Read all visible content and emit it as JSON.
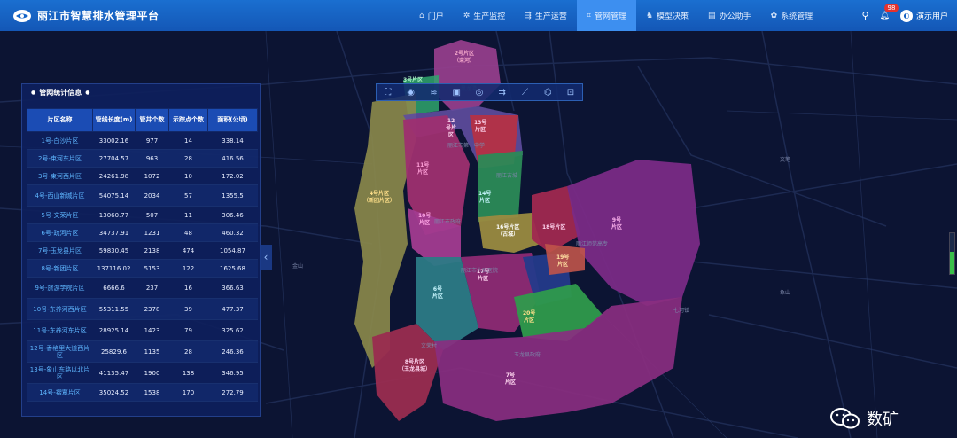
{
  "app": {
    "title": "丽江市智慧排水管理平台"
  },
  "nav": [
    {
      "label": "门户",
      "icon": "home-icon",
      "glyph": "⌂"
    },
    {
      "label": "生产监控",
      "icon": "gear-icon",
      "glyph": "✲"
    },
    {
      "label": "生产运营",
      "icon": "flow-icon",
      "glyph": "⇶"
    },
    {
      "label": "管网管理",
      "icon": "network-icon",
      "glyph": "⌗"
    },
    {
      "label": "模型决策",
      "icon": "model-icon",
      "glyph": "♞"
    },
    {
      "label": "办公助手",
      "icon": "document-icon",
      "glyph": "▤"
    },
    {
      "label": "系统管理",
      "icon": "settings-icon",
      "glyph": "✿"
    }
  ],
  "header_right": {
    "badge_count": "98",
    "user": "演示用户"
  },
  "panel": {
    "title": "管网统计信息",
    "columns": [
      "片区名称",
      "管线长度(m)",
      "管井个数",
      "示踪点个数",
      "面积(公顷)"
    ],
    "rows": [
      [
        "1号-白沙片区",
        "33002.16",
        "977",
        "14",
        "338.14"
      ],
      [
        "2号-束河东片区",
        "27704.57",
        "963",
        "28",
        "416.56"
      ],
      [
        "3号-束河西片区",
        "24261.98",
        "1072",
        "10",
        "172.02"
      ],
      [
        "4号-西山新城片区",
        "54075.14",
        "2034",
        "57",
        "1355.5"
      ],
      [
        "5号-文荣片区",
        "13060.77",
        "507",
        "11",
        "306.46"
      ],
      [
        "6号-疏河片区",
        "34737.91",
        "1231",
        "48",
        "460.32"
      ],
      [
        "7号-玉龙县片区",
        "59830.45",
        "2138",
        "474",
        "1054.87"
      ],
      [
        "8号-新团片区",
        "137116.02",
        "5153",
        "122",
        "1625.68"
      ],
      [
        "9号-旅游学院片区",
        "6666.6",
        "237",
        "16",
        "366.63"
      ],
      [
        "10号-东养河西片区",
        "55311.55",
        "2378",
        "39",
        "477.37"
      ],
      [
        "11号-东养河东片区",
        "28925.14",
        "1423",
        "79",
        "325.62"
      ],
      [
        "12号-香格里大道西片区",
        "25829.6",
        "1135",
        "28",
        "246.36"
      ],
      [
        "13号-象山东路以北片区",
        "41135.47",
        "1900",
        "138",
        "346.95"
      ],
      [
        "14号-褶覃片区",
        "35024.52",
        "1538",
        "170",
        "272.79"
      ]
    ]
  },
  "toolbar": [
    {
      "icon": "fullscreen-icon",
      "glyph": "⛶"
    },
    {
      "icon": "eye-icon",
      "glyph": "◉"
    },
    {
      "icon": "layers-icon",
      "glyph": "≋"
    },
    {
      "icon": "cube-icon",
      "glyph": "▣"
    },
    {
      "icon": "target-icon",
      "glyph": "◎"
    },
    {
      "icon": "filter-icon",
      "glyph": "⇉"
    },
    {
      "icon": "measure-icon",
      "glyph": "⟋"
    },
    {
      "icon": "route-icon",
      "glyph": "⌬"
    },
    {
      "icon": "select-icon",
      "glyph": "⊡"
    }
  ],
  "map": {
    "zones": [
      {
        "label": "2号片区\n（束河）",
        "color": "#f0a3c8"
      },
      {
        "label": "3号片区",
        "color": "#aef5c7"
      },
      {
        "label": "4号片区\n（新团片区）",
        "color": "#ffe08a"
      },
      {
        "label": "12\n号片\n区",
        "color": "#ffd6f0"
      },
      {
        "label": "13号\n片区",
        "color": "#ffd6f0"
      },
      {
        "label": "11号\n片区",
        "color": "#ff9fd8"
      },
      {
        "label": "10号\n片区",
        "color": "#ffa6e6"
      },
      {
        "label": "14号\n片区",
        "color": "#c8f7ff"
      },
      {
        "label": "16号片区\n（古城）",
        "color": "#ffffff"
      },
      {
        "label": "18号片区",
        "color": "#ffd6f0"
      },
      {
        "label": "9号\n片区",
        "color": "#ffb4f0"
      },
      {
        "label": "17号\n片区",
        "color": "#ffd6f0"
      },
      {
        "label": "19号\n片区",
        "color": "#ffe0a0"
      },
      {
        "label": "6号\n片区",
        "color": "#c8f7ff"
      },
      {
        "label": "20号\n片区",
        "color": "#ffe08a"
      },
      {
        "label": "8号片区\n（玉龙县城）",
        "color": "#ffd6f0"
      },
      {
        "label": "7号\n片区",
        "color": "#ffd6f0"
      }
    ],
    "labels": [
      "丽江市第一中学",
      "丽江古城",
      "丽江市政府",
      "丽江市人民医院",
      "玉龙县政府",
      "丽江师范高专",
      "文荣村",
      "文笔",
      "七河镇",
      "黑龙潭",
      "象山",
      "金山"
    ],
    "scale_level": 0.55
  },
  "watermark": {
    "text": "数矿"
  },
  "colors": {
    "header": "#1565c8",
    "active_tab": "#3d8ff0",
    "panel": "#0e205c",
    "table_header": "#1b4cb4"
  }
}
